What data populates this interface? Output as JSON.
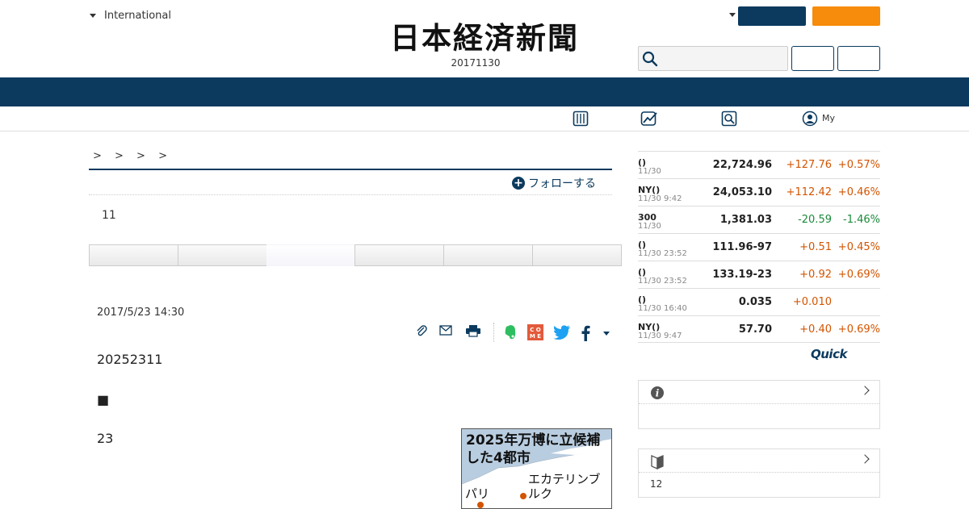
{
  "header": {
    "edition": "International",
    "logo": "日本経済新聞",
    "date": "20171130"
  },
  "subnav": {
    "my_label": "My"
  },
  "article": {
    "breadcrumb": "> > > >",
    "follow_label": "フォローする",
    "count": "11",
    "pubdate": "2017/5/23 14:30",
    "para1": "20252311",
    "para2": "■",
    "para3": "23",
    "figure": {
      "title": "2025年万博に立候補した4都市",
      "city_a": "エカテリンブルク",
      "city_b": "パリ"
    }
  },
  "market": {
    "rows": [
      {
        "name": "()",
        "time": "11/30",
        "value": "22,724.96",
        "change": "+127.76",
        "pct": "+0.57%",
        "dir": "up"
      },
      {
        "name": "NY()",
        "time": "11/30 9:42",
        "value": "24,053.10",
        "change": "+112.42",
        "pct": "+0.46%",
        "dir": "up"
      },
      {
        "name": "300",
        "time": "11/30",
        "value": "1,381.03",
        "change": "-20.59",
        "pct": "-1.46%",
        "dir": "down"
      },
      {
        "name": "()",
        "time": "11/30 23:52",
        "value": "111.96-97",
        "change": "+0.51",
        "pct": "+0.45%",
        "dir": "up"
      },
      {
        "name": "()",
        "time": "11/30 23:52",
        "value": "133.19-23",
        "change": "+0.92",
        "pct": "+0.69%",
        "dir": "up"
      },
      {
        "name": "()",
        "time": "11/30 16:40",
        "value": "0.035",
        "change": "+0.010",
        "pct": "",
        "dir": "up"
      },
      {
        "name": "NY()",
        "time": "11/30 9:47",
        "value": "57.70",
        "change": "+0.40",
        "pct": "+0.69%",
        "dir": "up"
      }
    ],
    "provider": "Quick"
  },
  "sidebar": {
    "ranking_text": "12"
  },
  "colors": {
    "navy": "#0b3a5e",
    "orange": "#f68b0c",
    "up": "#d35400",
    "down": "#1a8a3a"
  }
}
